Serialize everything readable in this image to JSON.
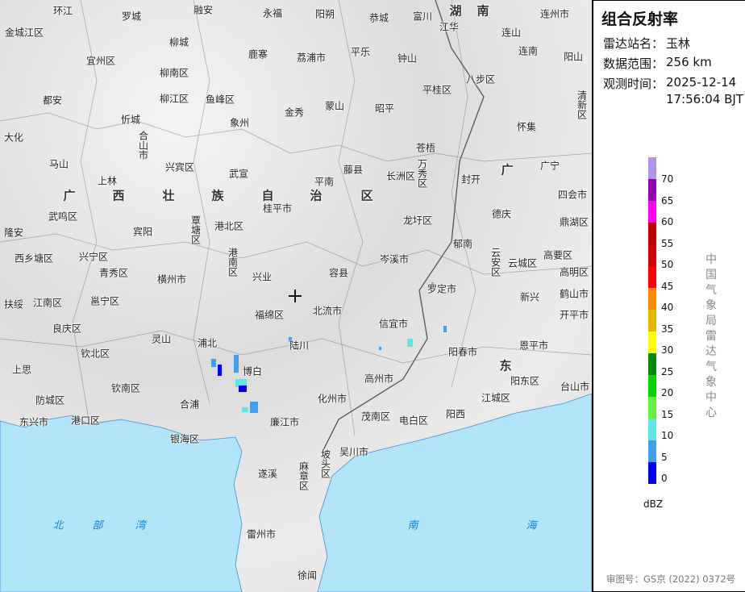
{
  "panel": {
    "title": "组合反射率",
    "station_label": "雷达站名：",
    "station": "玉林",
    "range_label": "数据范围：",
    "range": "256 km",
    "time_label": "观测时间：",
    "date": "2025-12-14",
    "time": "17:56:04 BJT",
    "legend": {
      "unit": "dBZ",
      "ticks": [
        "70",
        "65",
        "60",
        "55",
        "50",
        "45",
        "40",
        "35",
        "30",
        "25",
        "20",
        "15",
        "10",
        "5",
        "0"
      ],
      "colors": [
        "#b093eb",
        "#9500b0",
        "#ff00f0",
        "#c00000",
        "#d60000",
        "#ff0000",
        "#ff8c00",
        "#e6b800",
        "#ffff00",
        "#008a00",
        "#00d800",
        "#66f040",
        "#60e6e6",
        "#40a0f0",
        "#0000f6"
      ]
    },
    "org": "中国气象局雷达气象中心",
    "credit": "审图号：GS京 (2022) 0372号"
  },
  "map": {
    "sea_color": "#b2e4fa",
    "radar_site_icon": "cross-icon",
    "labels": [
      "环江",
      "罗城",
      "融安",
      "永福",
      "阳朔",
      "恭城",
      "富川",
      "湖　南",
      "连州市",
      "金城江区",
      "江华",
      "连山",
      "宜州区",
      "柳城",
      "鹿寨",
      "荔浦市",
      "平乐",
      "钟山",
      "连南",
      "阳山",
      "柳南区",
      "八步区",
      "都安",
      "柳江区",
      "鱼峰区",
      "金秀",
      "蒙山",
      "昭平",
      "平桂区",
      "清新区",
      "忻城",
      "象州",
      "怀集",
      "大化",
      "合山市",
      "苍梧",
      "马山",
      "兴宾区",
      "武宣",
      "平南",
      "藤县",
      "长洲区",
      "万秀区",
      "封开",
      "广宁",
      "广",
      "广",
      "西",
      "壮",
      "族",
      "自",
      "治",
      "区",
      "上林",
      "四会市",
      "桂平市",
      "龙圩区",
      "德庆",
      "鼎湖区",
      "武鸣区",
      "宾阳",
      "覃塘区",
      "港北区",
      "隆安",
      "郁南",
      "高要区",
      "西乡塘区",
      "兴宁区",
      "港南区",
      "岑溪市",
      "云安区",
      "云城区",
      "青秀区",
      "横州市",
      "兴业",
      "容县",
      "高明区",
      "江南区",
      "邕宁区",
      "罗定市",
      "新兴",
      "鹤山市",
      "扶绥",
      "福绵区",
      "北流市",
      "开平市",
      "良庆区",
      "灵山",
      "陆川",
      "信宜市",
      "恩平市",
      "钦北区",
      "浦北",
      "阳春市",
      "上思",
      "博白",
      "东",
      "阳东区",
      "台山市",
      "钦南区",
      "高州市",
      "防城区",
      "合浦",
      "化州市",
      "江城区",
      "东兴市",
      "港口区",
      "廉江市",
      "茂南区",
      "电白区",
      "阳西",
      "银海区",
      "吴川市",
      "坡头区",
      "遂溪",
      "麻章区",
      "北",
      "部",
      "湾",
      "南",
      "海",
      "雷州市",
      "徐闻"
    ]
  }
}
